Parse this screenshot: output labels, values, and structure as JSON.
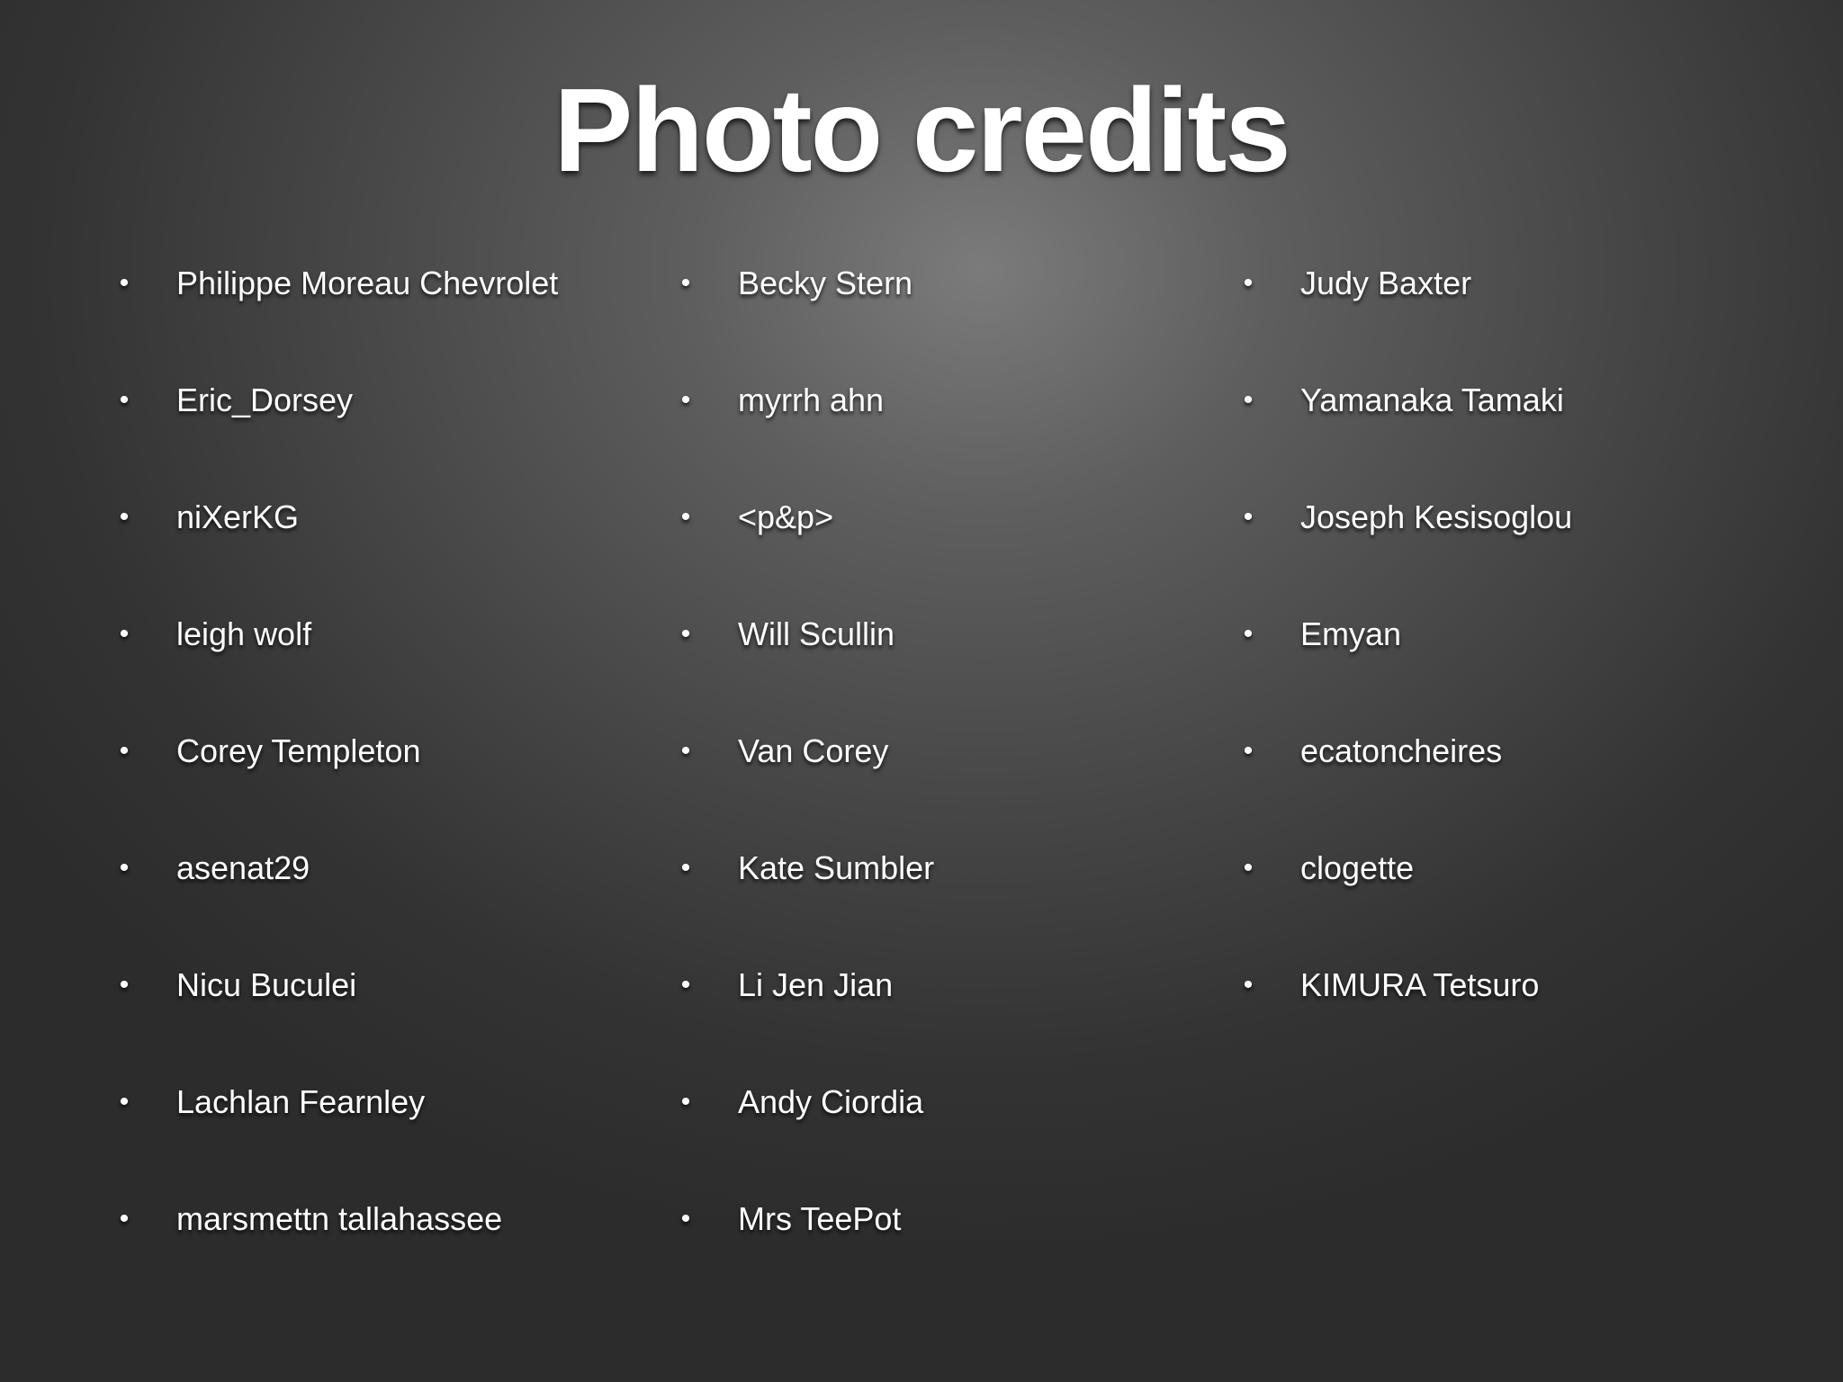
{
  "slide": {
    "title": "Photo credits",
    "bullet": "•",
    "columns": [
      {
        "credits": [
          "Philippe Moreau Chevrolet",
          "Eric_Dorsey",
          "niXerKG",
          "leigh wolf",
          "Corey Templeton",
          "asenat29",
          "Nicu Buculei",
          "Lachlan Fearnley",
          "marsmettn tallahassee"
        ]
      },
      {
        "credits": [
          "Becky Stern",
          "myrrh ahn",
          "<p&p>",
          "Will Scullin",
          "Van Corey",
          "Kate Sumbler",
          "Li Jen Jian",
          "Andy Ciordia",
          "Mrs TeePot"
        ]
      },
      {
        "credits": [
          "Judy Baxter",
          "Yamanaka Tamaki",
          "Joseph Kesisoglou",
          "Emyan",
          "ecatoncheires",
          "clogette",
          "KIMURA Tetsuro"
        ]
      }
    ]
  }
}
